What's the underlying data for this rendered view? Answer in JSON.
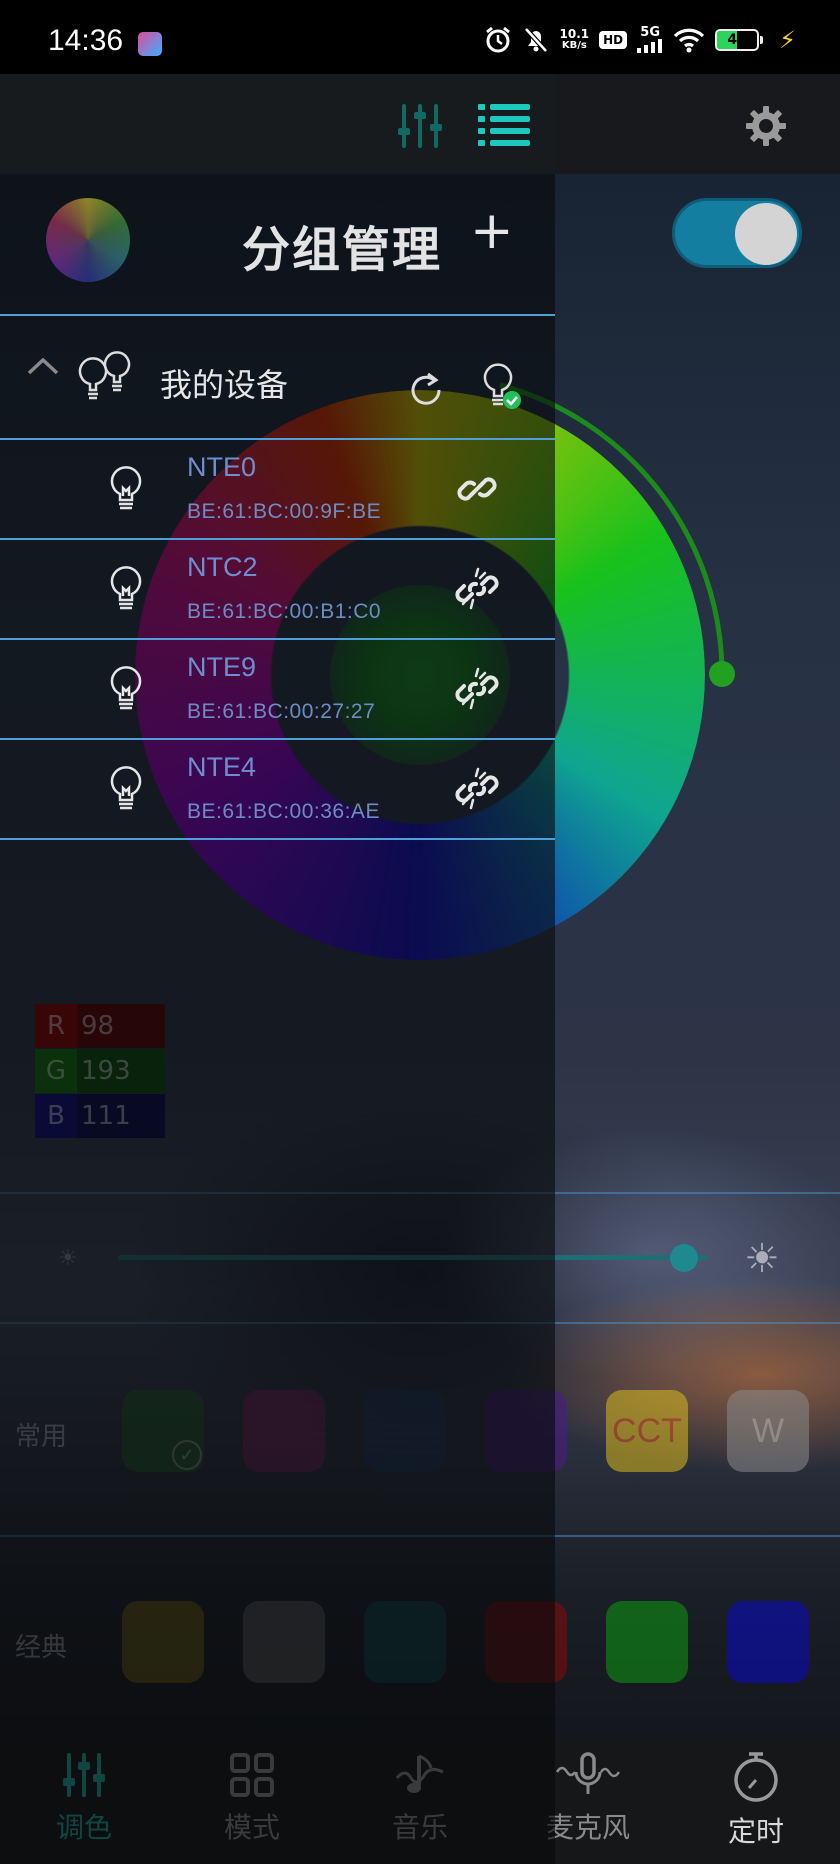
{
  "status_bar": {
    "time": "14:36",
    "net_speed_value": "10.1",
    "net_speed_unit": "KB/s",
    "hd_badge": "HD",
    "network": "5G",
    "battery_level": "49",
    "icons": [
      "app-icon",
      "alarm-icon",
      "mute-icon",
      "signal-icon",
      "wifi-icon",
      "battery-icon",
      "charging-icon"
    ]
  },
  "drawer": {
    "title": "分组管理",
    "add_label": "+",
    "group": {
      "name": "我的设备",
      "expanded": true
    },
    "devices": [
      {
        "name": "NTE0",
        "mac": "BE:61:BC:00:9F:BE",
        "link_status": "connected"
      },
      {
        "name": "NTC2",
        "mac": "BE:61:BC:00:B1:C0",
        "link_status": "disconnected"
      },
      {
        "name": "NTE9",
        "mac": "BE:61:BC:00:27:27",
        "link_status": "disconnected"
      },
      {
        "name": "NTE4",
        "mac": "BE:61:BC:00:36:AE",
        "link_status": "disconnected"
      }
    ]
  },
  "color_panel": {
    "rgb": [
      {
        "key": "R",
        "value": "98",
        "color": "#5a0000",
        "keycolor": "#8a0000"
      },
      {
        "key": "G",
        "value": "193",
        "color": "#0b4a0b",
        "keycolor": "#0f6e0f"
      },
      {
        "key": "B",
        "value": "111",
        "color": "#0a0a4a",
        "keycolor": "#0d0d7a"
      }
    ],
    "brightness_percent": 96,
    "power_on": true
  },
  "swatches": {
    "common_label": "常用",
    "common": [
      {
        "color": "#1e6a2a",
        "label": "",
        "selected": true
      },
      {
        "color": "#8a1f6e",
        "label": "",
        "selected": false
      },
      {
        "color": "#1a3a66",
        "label": "",
        "selected": false
      },
      {
        "color": "#4a1c8a",
        "label": "",
        "selected": false
      },
      {
        "color": "#d9b91e",
        "label": "CCT",
        "text_color": "#d9502a",
        "selected": false
      },
      {
        "color": "#8a8a8a",
        "label": "W",
        "text_color": "#c8c8c8",
        "selected": false
      }
    ],
    "classic_label": "经典",
    "classic": [
      {
        "color": "#8a7a10",
        "label": ""
      },
      {
        "color": "#6e6e6e",
        "label": ""
      },
      {
        "color": "#0e5a5a",
        "label": ""
      },
      {
        "color": "#8a0a0a",
        "label": ""
      },
      {
        "color": "#0f9a10",
        "label": ""
      },
      {
        "color": "#0a0ac8",
        "label": ""
      }
    ]
  },
  "bottom_nav": [
    {
      "label": "调色",
      "icon": "sliders-icon",
      "active": true
    },
    {
      "label": "模式",
      "icon": "grid-icon",
      "active": false
    },
    {
      "label": "音乐",
      "icon": "music-icon",
      "active": false
    },
    {
      "label": "麦克风",
      "icon": "microphone-icon",
      "active": false
    },
    {
      "label": "定时",
      "icon": "timer-icon",
      "active": false
    }
  ],
  "accent_color": "#1ec8c0"
}
